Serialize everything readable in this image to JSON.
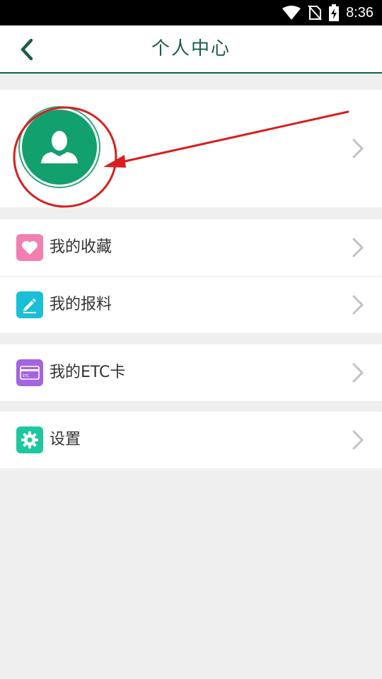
{
  "status_bar": {
    "time": "8:36",
    "icons": [
      "wifi-icon",
      "no-sim-icon",
      "battery-charging-icon"
    ]
  },
  "header": {
    "title": "个人中心",
    "back_icon": "chevron-left-icon"
  },
  "profile": {
    "avatar_icon": "user-avatar-icon"
  },
  "menu": {
    "favorites": {
      "label": "我的收藏",
      "icon": "heart-icon",
      "color": "#f27fb2"
    },
    "reports": {
      "label": "我的报料",
      "icon": "pencil-icon",
      "color": "#18bfd6"
    },
    "etc": {
      "label": "我的ETC卡",
      "icon": "card-icon",
      "color": "#a463e0",
      "card_text": "ETC"
    },
    "settings": {
      "label": "设置",
      "icon": "gear-icon",
      "color": "#1fc7a0"
    }
  },
  "colors": {
    "accent": "#1b5e45",
    "avatar": "#12a06e",
    "annotation": "#d81e1e"
  }
}
